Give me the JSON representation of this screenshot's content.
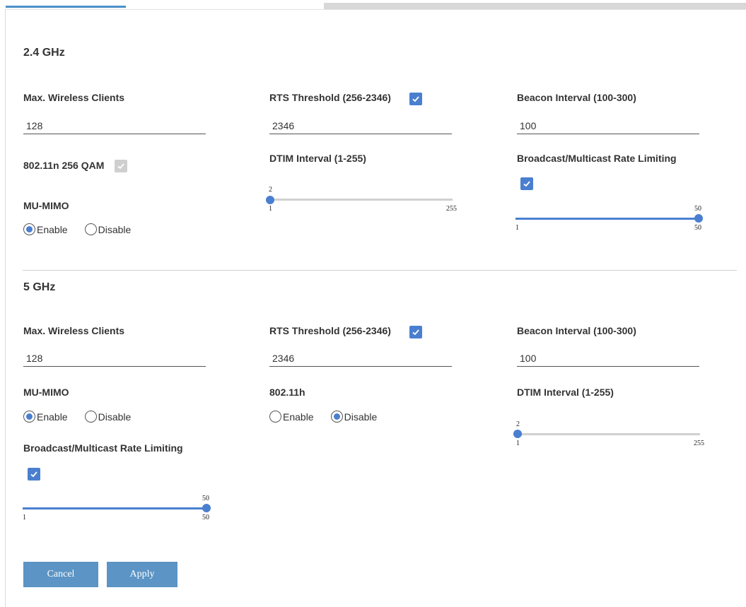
{
  "section24": {
    "title": "2.4 GHz",
    "max_clients": {
      "label": "Max. Wireless Clients",
      "value": "128"
    },
    "rts": {
      "label": "RTS Threshold (256-2346)",
      "value": "2346",
      "checked": true
    },
    "beacon": {
      "label": "Beacon Interval (100-300)",
      "value": "100"
    },
    "qam": {
      "label": "802.11n 256 QAM",
      "checked": true,
      "disabled": true
    },
    "dtim": {
      "label": "DTIM Interval (1-255)",
      "value": "2",
      "min": "1",
      "max": "255"
    },
    "bcast": {
      "label": "Broadcast/Multicast Rate Limiting",
      "checked": true,
      "value": "50",
      "min": "1",
      "max": "50"
    },
    "mumimo": {
      "label": "MU-MIMO",
      "enable": "Enable",
      "disable": "Disable",
      "selected": "Enable"
    }
  },
  "section5": {
    "title": "5 GHz",
    "max_clients": {
      "label": "Max. Wireless Clients",
      "value": "128"
    },
    "rts": {
      "label": "RTS Threshold (256-2346)",
      "value": "2346",
      "checked": true
    },
    "beacon": {
      "label": "Beacon Interval (100-300)",
      "value": "100"
    },
    "mumimo": {
      "label": "MU-MIMO",
      "enable": "Enable",
      "disable": "Disable",
      "selected": "Enable"
    },
    "h80211": {
      "label": "802.11h",
      "enable": "Enable",
      "disable": "Disable",
      "selected": "Disable"
    },
    "dtim": {
      "label": "DTIM Interval (1-255)",
      "value": "2",
      "min": "1",
      "max": "255"
    },
    "bcast": {
      "label": "Broadcast/Multicast Rate Limiting",
      "checked": true,
      "value": "50",
      "min": "1",
      "max": "50"
    }
  },
  "buttons": {
    "cancel": "Cancel",
    "apply": "Apply"
  },
  "colors": {
    "accent": "#4a7fd0",
    "button": "#5b94c5",
    "tab_active": "#4a90c8"
  }
}
